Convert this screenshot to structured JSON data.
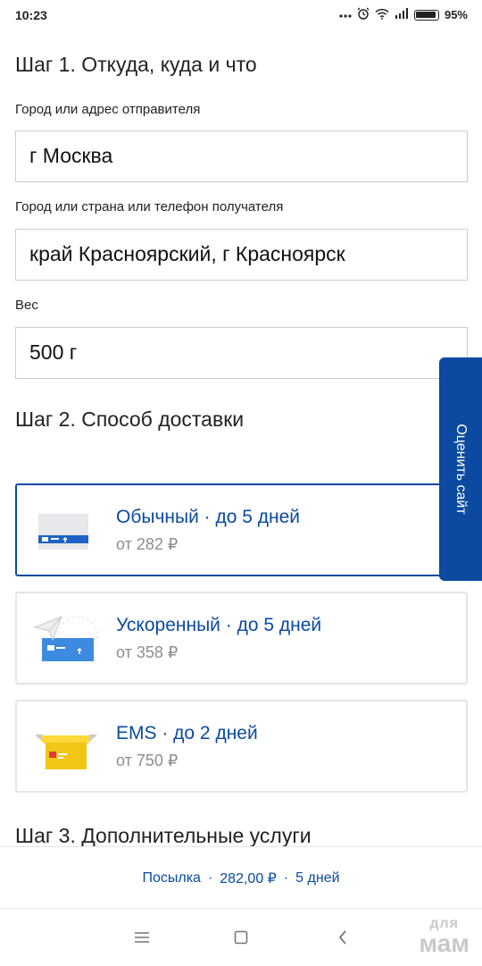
{
  "status_bar": {
    "time": "10:23",
    "battery": "95%"
  },
  "step1": {
    "title": "Шаг 1. Откуда, куда и что",
    "sender_label": "Город или адрес отправителя",
    "sender_value": "г Москва",
    "recipient_label": "Город или страна или телефон получателя",
    "recipient_value": "край Красноярский, г Красноярск",
    "weight_label": "Вес",
    "weight_value": "500 г"
  },
  "step2": {
    "title": "Шаг 2. Способ доставки",
    "options": [
      {
        "title": "Обычный · до 5 дней",
        "price": "от 282 ₽",
        "selected": true,
        "icon": "regular-parcel-icon"
      },
      {
        "title": "Ускоренный · до 5 дней",
        "price": "от 358 ₽",
        "selected": false,
        "icon": "express-parcel-icon"
      },
      {
        "title": "EMS · до 2 дней",
        "price": "от 750 ₽",
        "selected": false,
        "icon": "ems-parcel-icon"
      }
    ]
  },
  "step3": {
    "title": "Шаг 3. Дополнительные услуги"
  },
  "feedback_tab": {
    "label": "Оценить сайт"
  },
  "summary": {
    "type": "Посылка",
    "price": "282,00 ₽",
    "duration": "5 дней"
  },
  "watermark": {
    "line1": "для",
    "line2": "мам"
  },
  "colors": {
    "accent": "#0b4aa0",
    "border": "#c9cdd2",
    "muted": "#8a8e94"
  }
}
